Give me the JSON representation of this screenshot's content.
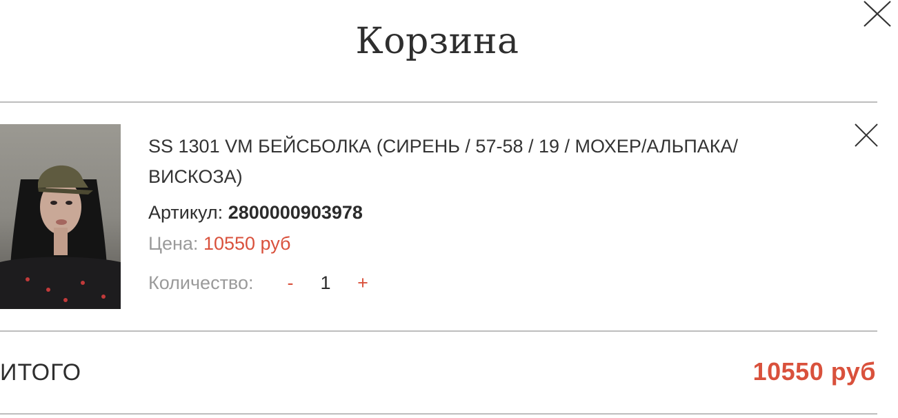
{
  "cart": {
    "title": "Корзина"
  },
  "item": {
    "image_alt": "Woman wearing a knitted baseball cap",
    "title": "SS 1301 VM БЕЙСБОЛКА (СИРЕНЬ / 57-58 / 19 / МОХЕР/АЛЬПАКА/ ВИСКОЗА)",
    "sku_label": "Артикул:",
    "sku_value": "2800000903978",
    "price_label": "Цена:",
    "price_value": "10550 руб",
    "qty_label": "Количество:",
    "qty_minus": "-",
    "qty_value": "1",
    "qty_plus": "+"
  },
  "summary": {
    "total_label": "ИТОГО",
    "total_value": "10550 руб"
  },
  "icons": {
    "modal_close": "close-icon",
    "remove_item": "close-icon"
  },
  "colors": {
    "accent": "#d9513c",
    "divider": "#bdbdbd",
    "muted_text": "#9a9a9a",
    "text": "#2e2e2e"
  }
}
